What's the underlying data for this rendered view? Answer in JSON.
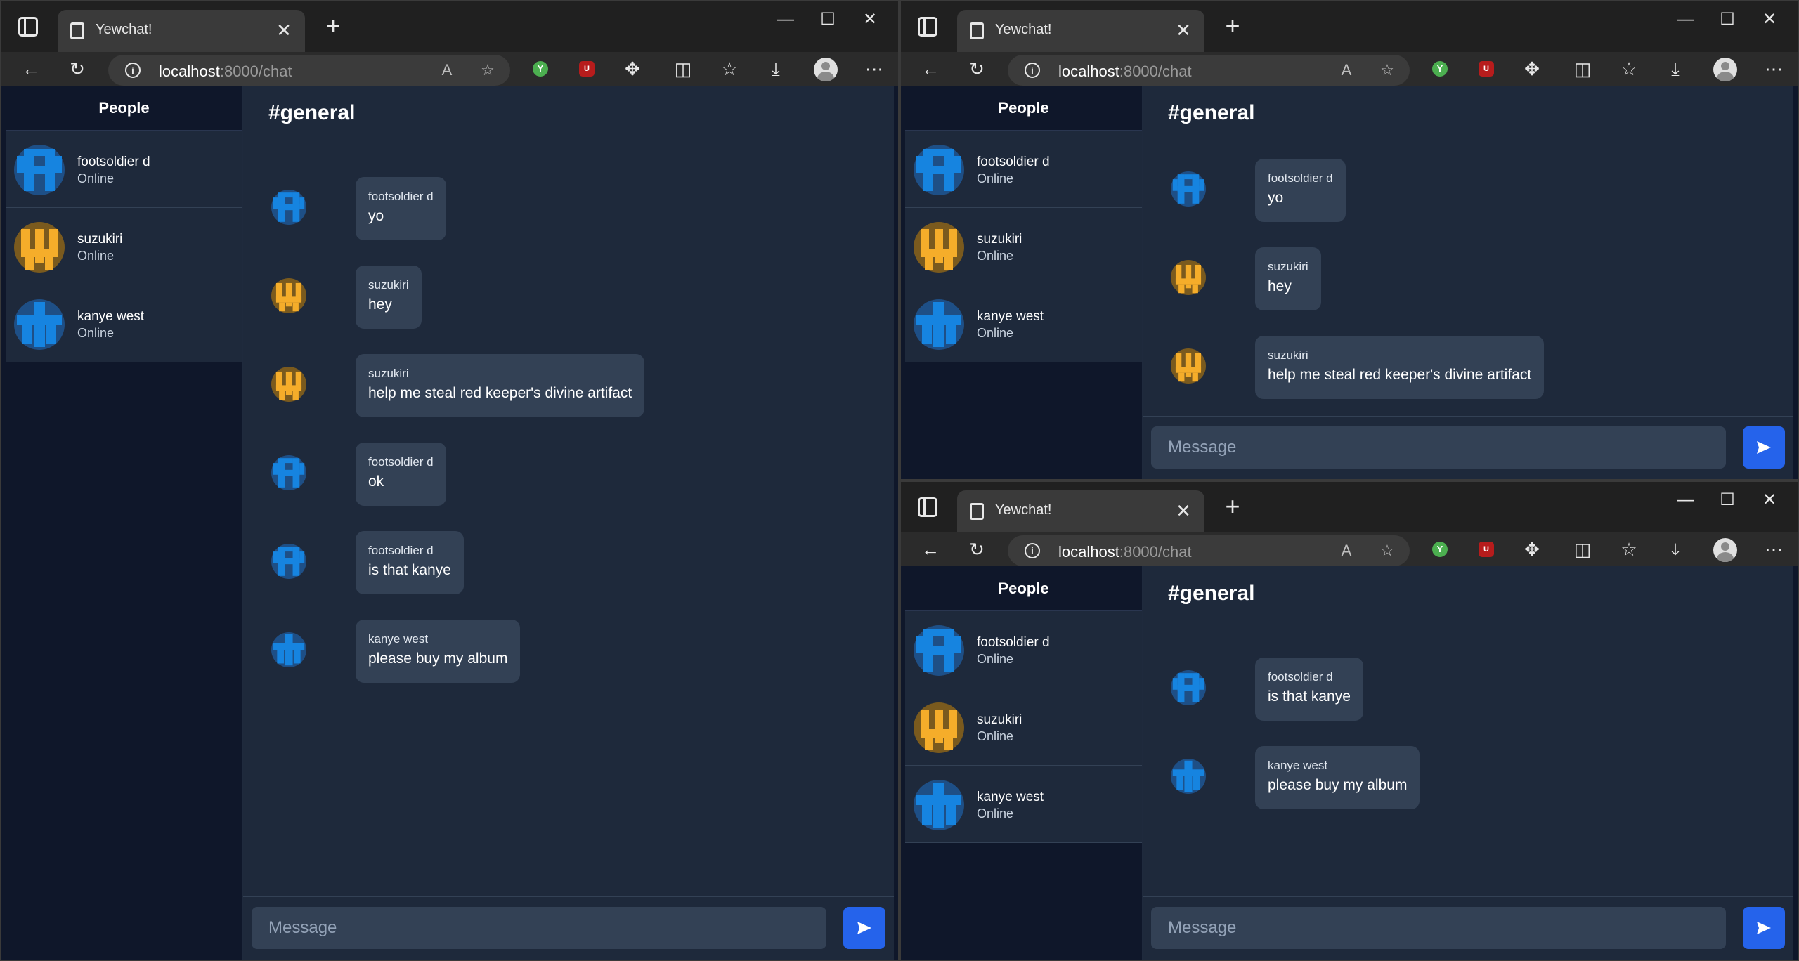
{
  "browser": {
    "tab_title": "Yewchat!",
    "url_host": "localhost",
    "url_path": ":8000/chat"
  },
  "app": {
    "people_header": "People",
    "channel": "#general",
    "composer_placeholder": "Message",
    "people": [
      {
        "name": "footsoldier d",
        "status": "Online",
        "color": "#1684e0",
        "icon": "h-glyph"
      },
      {
        "name": "suzukiri",
        "status": "Online",
        "color": "#f5ad2a",
        "icon": "trident-glyph"
      },
      {
        "name": "kanye west",
        "status": "Online",
        "color": "#1684e0",
        "icon": "cross-glyph"
      }
    ]
  },
  "windows": [
    {
      "messages": [
        {
          "sender": "footsoldier d",
          "text": "yo"
        },
        {
          "sender": "suzukiri",
          "text": "hey"
        },
        {
          "sender": "suzukiri",
          "text": "help me steal red keeper's divine artifact"
        },
        {
          "sender": "footsoldier d",
          "text": "ok"
        },
        {
          "sender": "footsoldier d",
          "text": "is that kanye"
        },
        {
          "sender": "kanye west",
          "text": "please buy my album"
        }
      ]
    },
    {
      "messages": [
        {
          "sender": "footsoldier d",
          "text": "yo"
        },
        {
          "sender": "suzukiri",
          "text": "hey"
        },
        {
          "sender": "suzukiri",
          "text": "help me steal red keeper's divine artifact"
        }
      ]
    },
    {
      "messages": [
        {
          "sender": "footsoldier d",
          "text": "is that kanye"
        },
        {
          "sender": "kanye west",
          "text": "please buy my album"
        }
      ]
    }
  ]
}
